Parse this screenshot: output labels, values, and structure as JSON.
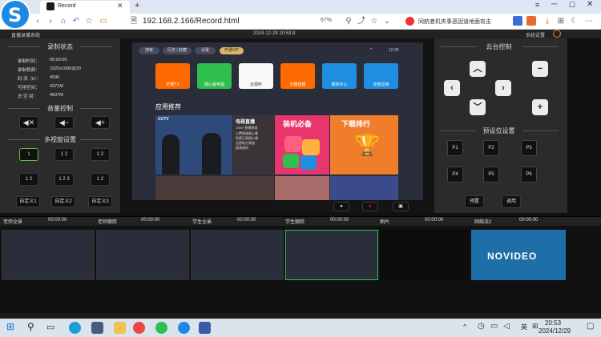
{
  "browser": {
    "tab_title": "Record",
    "address": "192.168.2.166/Record.html",
    "zoom": "67%",
    "news_ticker": "同航者机夹事恶因道地面攻击"
  },
  "app": {
    "header_left": "直播录播系统",
    "header_datetime": "2024-12-29 20:53:8",
    "header_right": "系统设置",
    "status_title": "录制状态",
    "status_rows": [
      {
        "label": "录制时间：",
        "value": "00:00:00"
      },
      {
        "label": "录制视频：",
        "value": "1920x1080@30"
      },
      {
        "label": "码 流（k）：",
        "value": "4096"
      },
      {
        "label": "可用空间：",
        "value": "4371M"
      },
      {
        "label": "总 空 间：",
        "value": "4837M"
      }
    ],
    "volume_title": "音量控制",
    "volume_buttons": [
      "mute-icon",
      "volume-down-icon",
      "volume-up-icon"
    ],
    "multiview_title": "多视窗设置",
    "layouts": [
      {
        "label": "1"
      },
      {
        "label": "1 2"
      },
      {
        "label": "1 2"
      },
      {
        "label": "1 2"
      },
      {
        "label": "1 2 3"
      },
      {
        "label": "1 2"
      }
    ],
    "custom_buttons": [
      "自定义1",
      "自定义2",
      "自定义3"
    ],
    "ptz_title": "云台控制",
    "preset_title": "预设位设置",
    "presets": [
      "P1",
      "P2",
      "P3",
      "P4",
      "P5",
      "P6"
    ],
    "preset_actions": [
      "预置",
      "调用"
    ],
    "player_controls": [
      "circle-icon",
      "record-icon",
      "camera-icon"
    ],
    "strip_channels": [
      {
        "label": "老师全景",
        "time": "00:00:00"
      },
      {
        "label": "老师跟踪",
        "time": "00:00:00"
      },
      {
        "label": "学生全景",
        "time": "00:00:00"
      },
      {
        "label": "学生跟踪",
        "time": "00:00:00"
      },
      {
        "label": "图片",
        "time": "00:00:00"
      },
      {
        "label": "网络流2",
        "time": "00:00:00"
      }
    ],
    "brand_text": "NOVIDEO"
  },
  "tv": {
    "search": "搜索",
    "history": "历史 | 收藏",
    "settings": "设置",
    "vip": "开通VIP",
    "clock": "12:39",
    "apps": [
      {
        "label": "芒果TV",
        "color": "#ff6a00"
      },
      {
        "label": "随心看电视",
        "color": "#2fbf4f"
      },
      {
        "label": "云视听",
        "color": "#f8f8f8"
      },
      {
        "label": "天猫直播",
        "color": "#ff6a00"
      },
      {
        "label": "媒体中心",
        "color": "#1e8fe0"
      },
      {
        "label": "全部应用",
        "color": "#1e8fe0"
      }
    ],
    "recommend_title": "应用推荐",
    "cards": [
      "电视直播",
      "1000+直播频道",
      "装机必备",
      "下载排行"
    ],
    "live_lines": [
      "公费频道随心看",
      "免费正版随心看",
      "全国地方频道",
      "超清画质"
    ]
  },
  "taskbar": {
    "time": "20:53",
    "date": "2024/12/29",
    "lang": "英"
  }
}
